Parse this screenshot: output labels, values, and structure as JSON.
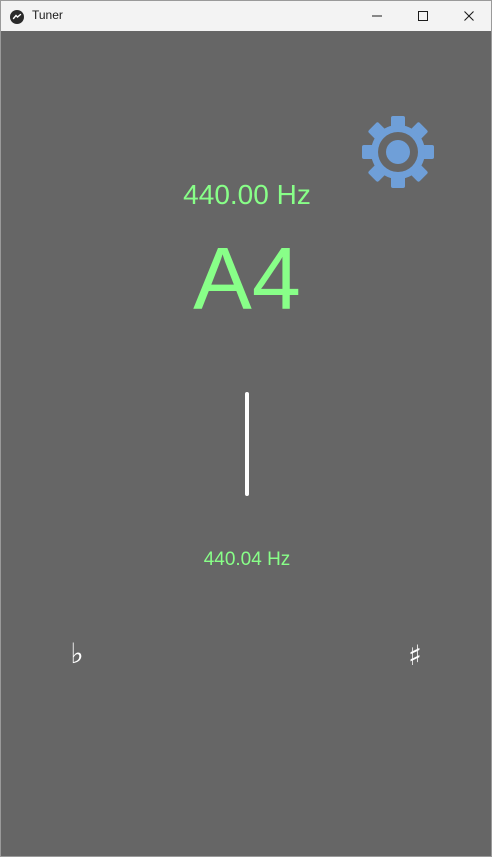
{
  "window": {
    "title": "Tuner",
    "controls": {
      "minimize_icon": "minimize-icon",
      "maximize_icon": "maximize-icon",
      "close_icon": "close-icon"
    }
  },
  "tuner": {
    "target_frequency": "440.00 Hz",
    "note": "A4",
    "detected_frequency": "440.04 Hz",
    "flat_symbol": "♭",
    "sharp_symbol": "♯",
    "settings_icon": "gear-icon"
  },
  "colors": {
    "background": "#666666",
    "text_accent": "#88ff88",
    "needle": "#ffffff",
    "gear": "#6f9fd8",
    "titlebar": "#f3f3f3"
  }
}
